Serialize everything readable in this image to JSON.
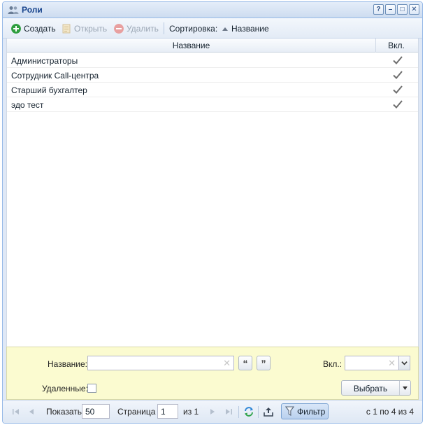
{
  "window": {
    "title": "Роли",
    "tools": [
      "?",
      "–",
      "□",
      "✕"
    ]
  },
  "toolbar": {
    "create_label": "Создать",
    "open_label": "Открыть",
    "delete_label": "Удалить",
    "sort_label": "Сортировка:",
    "sort_value": "Название"
  },
  "grid": {
    "columns": [
      "Название",
      "Вкл."
    ],
    "rows": [
      {
        "name": "Администраторы",
        "enabled": true
      },
      {
        "name": "Сотрудник Call-центра",
        "enabled": true
      },
      {
        "name": "Старший бухгалтер",
        "enabled": true
      },
      {
        "name": "эдо тест",
        "enabled": true
      }
    ]
  },
  "filter": {
    "name_label": "Название:",
    "name_value": "",
    "vkl_label": "Вкл.:",
    "vkl_value": "",
    "deleted_label": "Удаленные:",
    "select_label": "Выбрать"
  },
  "paging": {
    "show_label": "Показать",
    "page_size": "50",
    "page_label": "Страница",
    "page_value": "1",
    "of_label": "из 1",
    "filter_label": "Фильтр",
    "summary": "с 1 по 4 из 4"
  },
  "colors": {
    "title": "#15428b",
    "create_icon": "#2e9e3f",
    "delete_icon": "#e8a0a0"
  }
}
